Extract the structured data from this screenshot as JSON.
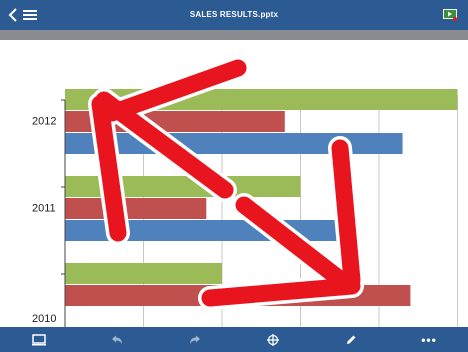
{
  "header": {
    "title": "SALES RESULTS.pptx"
  },
  "colors": {
    "toolbar": "#2b5b92",
    "series_green": "#9bbb59",
    "series_red": "#c0504d",
    "series_blue": "#4f81bd",
    "annotation_arrow": "#e8151f"
  },
  "icons": {
    "back": "chevron-left-icon",
    "menu": "hamburger-menu-icon",
    "present": "present-slideshow-icon",
    "slides": "slides-panel-icon",
    "undo": "undo-icon",
    "redo": "redo-icon",
    "insert": "insert-crosshair-icon",
    "pen": "pen-icon",
    "more": "more-options-icon"
  },
  "toolbar": {
    "more_label": "•••"
  },
  "chart_data": {
    "type": "bar",
    "orientation": "horizontal",
    "categories": [
      "2010",
      "2011",
      "2012"
    ],
    "series": [
      {
        "color": "#4f81bd",
        "values": [
          null,
          3.6,
          4.3
        ]
      },
      {
        "color": "#c0504d",
        "values": [
          4.4,
          1.8,
          2.8
        ]
      },
      {
        "color": "#9bbb59",
        "values": [
          2.0,
          3.0,
          5.0
        ]
      }
    ],
    "xlim": [
      0,
      5
    ],
    "grid": true
  }
}
